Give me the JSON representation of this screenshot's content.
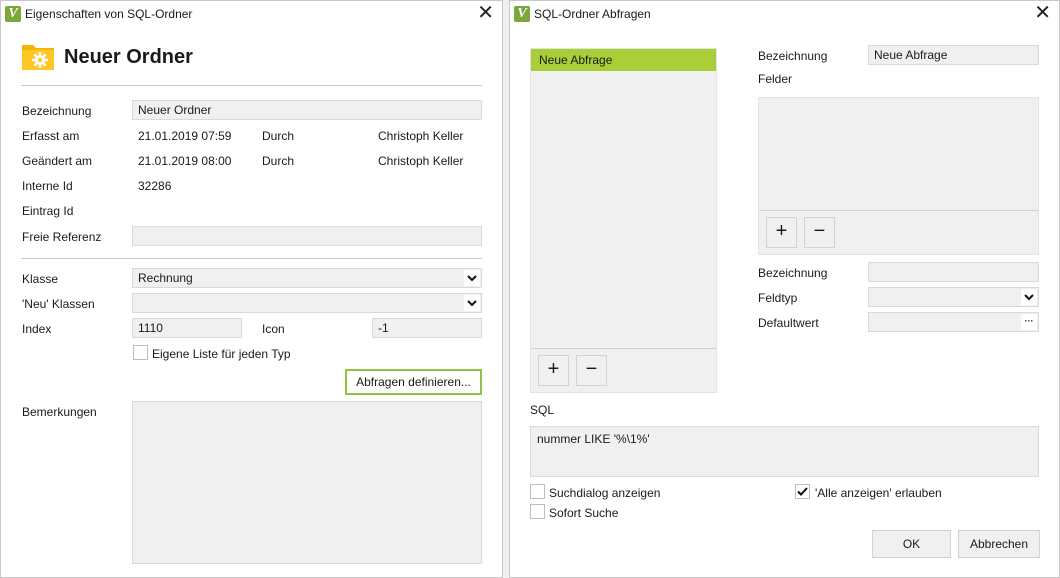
{
  "win1": {
    "title": "Eigenschaften von SQL-Ordner",
    "header": "Neuer Ordner",
    "labels": {
      "bezeichnung": "Bezeichnung",
      "erfasst": "Erfasst am",
      "geaendert": "Geändert am",
      "interne_id": "Interne Id",
      "eintrag_id": "Eintrag Id",
      "freie_ref": "Freie Referenz",
      "klasse": "Klasse",
      "neu_klassen": "'Neu' Klassen",
      "index": "Index",
      "icon": "Icon",
      "bemerkungen": "Bemerkungen",
      "durch": "Durch"
    },
    "values": {
      "bezeichnung": "Neuer Ordner",
      "erfasst_datum": "21.01.2019 07:59",
      "erfasst_user": "Christoph Keller",
      "geaendert_datum": "21.01.2019 08:00",
      "geaendert_user": "Christoph Keller",
      "interne_id": "32286",
      "eintrag_id": "",
      "freie_ref": "",
      "klasse": "Rechnung",
      "neu_klassen": "",
      "index": "1110",
      "icon": "-1",
      "bemerkungen": ""
    },
    "checkbox_label": "Eigene Liste für jeden Typ",
    "abfragen_button": "Abfragen definieren..."
  },
  "win2": {
    "title": "SQL-Ordner Abfragen",
    "list_items": [
      "Neue Abfrage"
    ],
    "labels": {
      "bezeichnung": "Bezeichnung",
      "felder": "Felder",
      "bezeichnung2": "Bezeichnung",
      "feldtyp": "Feldtyp",
      "defaultwert": "Defaultwert",
      "sql": "SQL"
    },
    "values": {
      "bezeichnung": "Neue Abfrage",
      "bezeichnung2": "",
      "feldtyp": "",
      "defaultwert": "",
      "sql": "nummer LIKE '%\\1%'"
    },
    "plus": "+",
    "minus": "−",
    "ellipsis": "···",
    "checkboxes": {
      "suchdialog": "Suchdialog anzeigen",
      "sofort": "Sofort Suche",
      "alle": "'Alle anzeigen' erlauben"
    },
    "ok": "OK",
    "cancel": "Abbrechen"
  },
  "app_icon_letter": "V",
  "close_glyph": "✕",
  "colors": {
    "accent_green": "#a8cf38",
    "button_border_green": "#8cc63f",
    "folder_yellow": "#f5b400",
    "app_icon": "#7aa83a"
  }
}
